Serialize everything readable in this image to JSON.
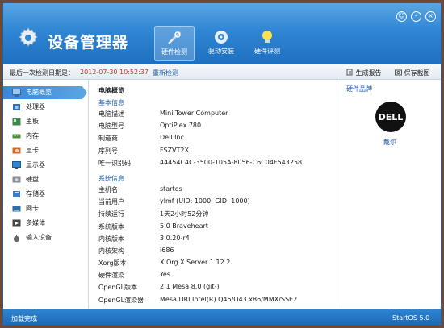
{
  "app": {
    "title": "设备管理器"
  },
  "tabs": [
    {
      "label": "硬件检测"
    },
    {
      "label": "驱动安装"
    },
    {
      "label": "硬件评测"
    }
  ],
  "toolbar": {
    "last_check_label": "最后一次检测日期是：",
    "last_check_time": "2012-07-30 10:52:37",
    "recheck": "重新检测",
    "report": "生成报告",
    "screenshot": "保存截图"
  },
  "sidebar": {
    "items": [
      {
        "label": "电脑概览",
        "icon": "computer-icon"
      },
      {
        "label": "处理器",
        "icon": "cpu-icon"
      },
      {
        "label": "主板",
        "icon": "motherboard-icon"
      },
      {
        "label": "内存",
        "icon": "memory-icon"
      },
      {
        "label": "显卡",
        "icon": "graphics-card-icon"
      },
      {
        "label": "显示器",
        "icon": "monitor-icon"
      },
      {
        "label": "硬盘",
        "icon": "hard-disk-icon"
      },
      {
        "label": "存储器",
        "icon": "storage-icon"
      },
      {
        "label": "网卡",
        "icon": "network-card-icon"
      },
      {
        "label": "多媒体",
        "icon": "multimedia-icon"
      },
      {
        "label": "输入设备",
        "icon": "input-device-icon"
      }
    ]
  },
  "overview": {
    "title": "电脑概览",
    "basic_section": "基本信息",
    "basic": [
      {
        "k": "电脑描述",
        "v": "Mini Tower Computer"
      },
      {
        "k": "电脑型号",
        "v": "OptiPlex 780"
      },
      {
        "k": "制造商",
        "v": "Dell Inc."
      },
      {
        "k": "序列号",
        "v": "FSZVT2X"
      },
      {
        "k": "唯一识别码",
        "v": "44454C4C-3500-105A-8056-C6C04F543258"
      }
    ],
    "system_section": "系统信息",
    "system": [
      {
        "k": "主机名",
        "v": "startos"
      },
      {
        "k": "当前用户",
        "v": "ylmf (UID: 1000, GID: 1000)"
      },
      {
        "k": "持续运行",
        "v": "1天2小时52分钟"
      },
      {
        "k": "系统版本",
        "v": "5.0 Braveheart"
      },
      {
        "k": "内核版本",
        "v": "3.0.20-r4"
      },
      {
        "k": "内核架构",
        "v": "i686"
      },
      {
        "k": "Xorg版本",
        "v": "X.Org X Server 1.12.2"
      },
      {
        "k": "硬件渲染",
        "v": "Yes"
      },
      {
        "k": "OpenGL版本",
        "v": "2.1 Mesa 8.0 (git-)"
      },
      {
        "k": "OpenGL渲染器",
        "v": "Mesa DRI Intel(R) Q45/Q43 x86/MMX/SSE2"
      }
    ]
  },
  "brand": {
    "label": "硬件品牌",
    "logo_text": "DELL",
    "name": "戴尔"
  },
  "footer": {
    "status": "加载完成",
    "os": "StartOS 5.0"
  },
  "colors": {
    "accent": "#2f86d3",
    "timestamp": "#c23a2a",
    "link": "#1e5eb0"
  }
}
